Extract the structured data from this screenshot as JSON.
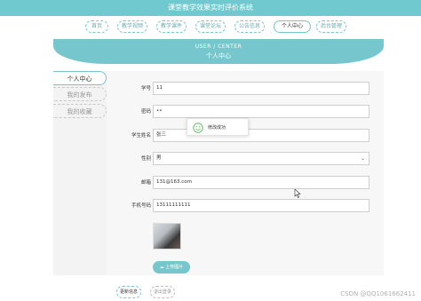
{
  "app": {
    "title": "课堂教学效果实时评价系统"
  },
  "nav": {
    "items": [
      {
        "label": "首页"
      },
      {
        "label": "教学视频"
      },
      {
        "label": "教学课件"
      },
      {
        "label": "课堂论坛"
      },
      {
        "label": "公告信息"
      },
      {
        "label": "个人中心"
      },
      {
        "label": "后台管理"
      }
    ],
    "active_index": 5
  },
  "banner": {
    "title_en": "USER / CENTER",
    "title_cn": "个人中心"
  },
  "sidebar": {
    "items": [
      {
        "label": "个人中心"
      },
      {
        "label": "我的发布"
      },
      {
        "label": "我的收藏"
      }
    ]
  },
  "form": {
    "student_id": {
      "label": "学号",
      "value": "11"
    },
    "password": {
      "label": "密码",
      "value": "••"
    },
    "student_name": {
      "label": "学生姓名",
      "value": "张三"
    },
    "gender": {
      "label": "性别",
      "value": "男"
    },
    "email": {
      "label": "邮箱",
      "value": "131@163.com"
    },
    "phone": {
      "label": "手机号码",
      "value": "13111111111"
    }
  },
  "buttons": {
    "upload": "上传图片",
    "update": "更新信息",
    "logout": "退出登录"
  },
  "toast": {
    "text": "修改成功"
  },
  "watermark": "CSDN @QQ1061662411",
  "colors": {
    "accent": "#75c7cd",
    "topbar": "#6fc9cf"
  }
}
